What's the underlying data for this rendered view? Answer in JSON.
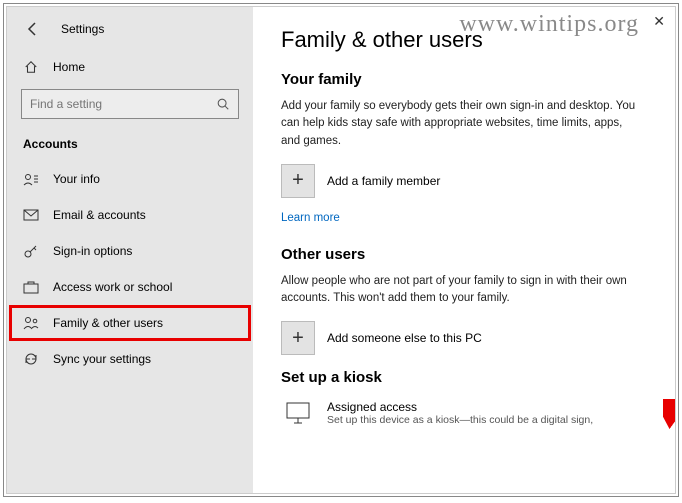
{
  "window": {
    "title": "Settings"
  },
  "sidebar": {
    "home": "Home",
    "search_placeholder": "Find a setting",
    "section": "Accounts",
    "items": [
      {
        "label": "Your info"
      },
      {
        "label": "Email & accounts"
      },
      {
        "label": "Sign-in options"
      },
      {
        "label": "Access work or school"
      },
      {
        "label": "Family & other users"
      },
      {
        "label": "Sync your settings"
      }
    ]
  },
  "main": {
    "heading": "Family & other users",
    "family": {
      "title": "Your family",
      "desc": "Add your family so everybody gets their own sign-in and desktop. You can help kids stay safe with appropriate websites, time limits, apps, and games.",
      "add": "Add a family member",
      "learn": "Learn more"
    },
    "other": {
      "title": "Other users",
      "desc": "Allow people who are not part of your family to sign in with their own accounts. This won't add them to your family.",
      "add": "Add someone else to this PC"
    },
    "kiosk": {
      "title": "Set up a kiosk",
      "name": "Assigned access",
      "sub": "Set up this device as a kiosk—this could be a digital sign,"
    }
  },
  "watermark": "www.wintips.org"
}
